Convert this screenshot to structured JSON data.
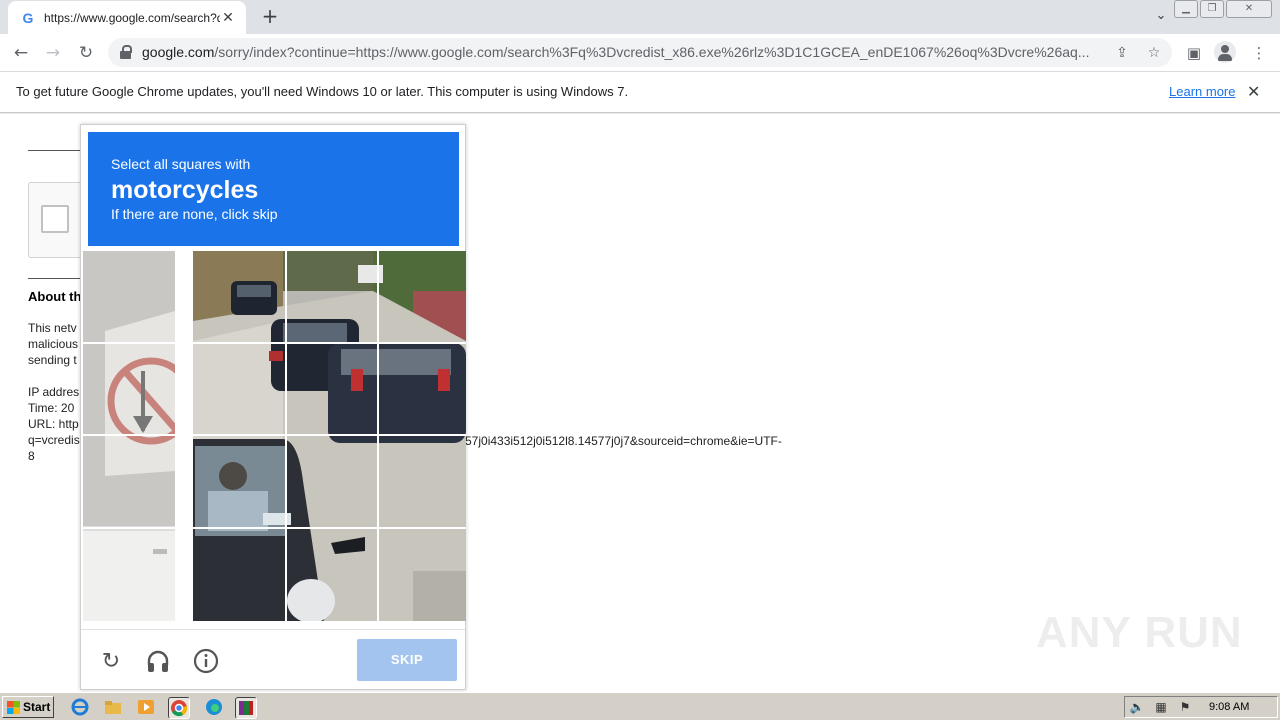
{
  "browser": {
    "tab_title": "https://www.google.com/search?q=",
    "url_host": "google.com",
    "url_path": "/sorry/index?continue=https://www.google.com/search%3Fq%3Dvcredist_x86.exe%26rlz%3D1C1GCEA_enDE1067%26oq%3Dvcre%26aq..."
  },
  "infobar": {
    "message": "To get future Google Chrome updates, you'll need Windows 10 or later. This computer is using Windows 7.",
    "link": "Learn more"
  },
  "page": {
    "about_heading": "About th",
    "text_lines": [
      "This netv",
      "malicious",
      "sending t"
    ],
    "ip_line": "IP addres",
    "time_line": "Time: 20",
    "url_line": "URL: http",
    "q_line": "q=vcredis",
    "eight_line": "8",
    "tail_text": "57j0i433i512j0i512l8.14577j0j7&sourceid=chrome&ie=UTF-"
  },
  "captcha": {
    "instruction_line1": "Select all squares with",
    "target": "motorcycles",
    "instruction_line3": "If there are none, click skip",
    "skip_label": "SKIP",
    "grid_rows": 4,
    "grid_cols": 4
  },
  "watermark": "ANY RUN",
  "taskbar": {
    "start_label": "Start",
    "clock": "9:08 AM"
  }
}
